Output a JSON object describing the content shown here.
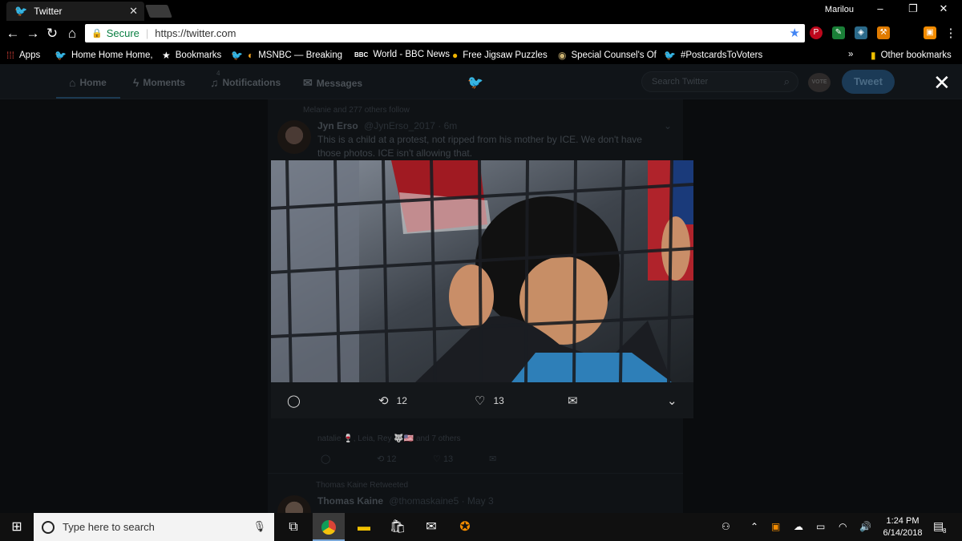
{
  "browser": {
    "tab_title": "Twitter",
    "tab_close": "✕",
    "profile_name": "Marilou",
    "address_secure": "Secure",
    "address_url": "https://twitter.com",
    "bookmarks": [
      {
        "label": "Apps",
        "icon": "apps-grid-icon"
      },
      {
        "label": "Home Home Home,",
        "icon": "twitter-bird-icon"
      },
      {
        "label": "Bookmarks",
        "icon": "star-icon"
      },
      {
        "label": "MSNBC — Breaking",
        "icon": "nbc-peacock-icon"
      },
      {
        "label": "World - BBC News",
        "icon": "bbc-icon"
      },
      {
        "label": "Free Jigsaw Puzzles",
        "icon": "puzzle-icon"
      },
      {
        "label": "Special Counsel's Of",
        "icon": "seal-icon"
      },
      {
        "label": "#PostcardsToVoters",
        "icon": "twitter-bird-icon"
      }
    ],
    "bookmarks_more": "»",
    "other_bookmarks": "Other bookmarks"
  },
  "twitter_nav": {
    "home": "Home",
    "moments": "Moments",
    "notifications": "Notifications",
    "notifications_badge": "4",
    "messages": "Messages",
    "search_placeholder": "Search Twitter",
    "vote_badge": "VOTE",
    "tweet_button": "Tweet"
  },
  "timeline": {
    "tweet1": {
      "social_context": "Melanie and 277 others follow",
      "name": "Jyn Erso",
      "handle": "@JynErso_2017 · 6m",
      "text": "This is a child at a protest, not ripped from his mother by ICE.  We don't have those photos. ICE isn't allowing that."
    },
    "liked_by": "natalie 🍷, Leia, Rey 🐺🇺🇸 and 7 others",
    "tweet1_retweets": "12",
    "tweet1_likes": "13",
    "tweet2": {
      "social_context": "Thomas Kaine Retweeted",
      "name": "Thomas Kaine",
      "handle": "@thomaskaine5 · May 3"
    }
  },
  "photo_overlay": {
    "retweets": "12",
    "likes": "13"
  },
  "taskbar": {
    "search_placeholder": "Type here to search",
    "time": "1:24 PM",
    "date": "6/14/2018",
    "notifications_count": "8"
  },
  "colors": {
    "twitter_blue": "#1da1f2",
    "secure_green": "#0b8043"
  }
}
